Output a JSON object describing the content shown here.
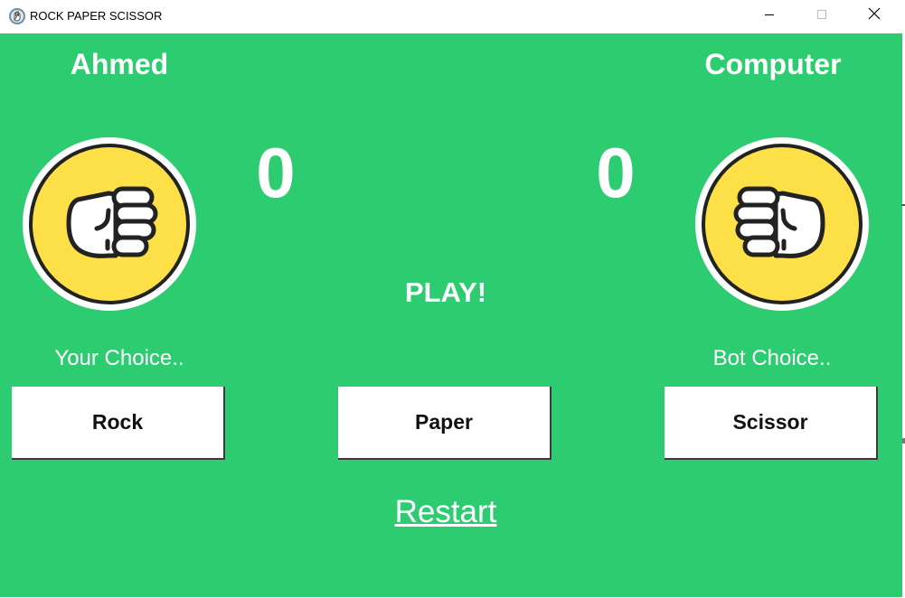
{
  "window": {
    "title": "ROCK PAPER SCISSOR",
    "icon": "hand-app-icon",
    "controls": [
      "minimize-icon",
      "maximize-icon",
      "close-icon"
    ]
  },
  "colors": {
    "background": "#2ecc71",
    "text": "#ffffff",
    "hand_face": "#fde047",
    "button_bg": "#ffffff"
  },
  "players": {
    "left": {
      "name": "Ahmed",
      "score": "0",
      "choice_label": "Your Choice..",
      "hand_icon": "rock-fist-icon"
    },
    "right": {
      "name": "Computer",
      "score": "0",
      "choice_label": "Bot Choice..",
      "hand_icon": "rock-fist-icon"
    }
  },
  "status": "PLAY!",
  "buttons": {
    "rock": "Rock",
    "paper": "Paper",
    "scissor": "Scissor"
  },
  "restart": "Restart"
}
